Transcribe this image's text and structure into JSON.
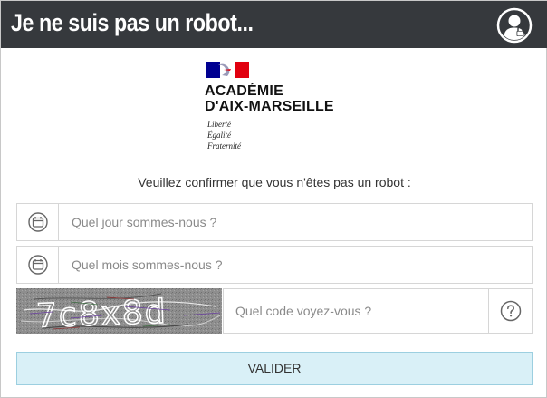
{
  "header": {
    "title": "Je ne suis pas un robot...",
    "icon": "user-lock-icon",
    "background": "#36393d"
  },
  "logo": {
    "line1": "ACADÉMIE",
    "line2": "D'AIX-MARSEILLE",
    "motto": [
      "Liberté",
      "Égalité",
      "Fraternité"
    ],
    "flag_colors": [
      "#000091",
      "#ffffff",
      "#e1000f"
    ]
  },
  "prompt": "Veuillez confirmer que vous n'êtes pas un robot :",
  "fields": {
    "day": {
      "placeholder": "Quel jour sommes-nous ?",
      "value": "",
      "icon": "calendar-icon"
    },
    "month": {
      "placeholder": "Quel mois sommes-nous ?",
      "value": "",
      "icon": "calendar-icon"
    }
  },
  "captcha": {
    "code": "7c8x8d",
    "placeholder": "Quel code voyez-vous ?",
    "value": "",
    "help_icon": "question-circle-icon"
  },
  "submit": {
    "label": "VALIDER",
    "background": "#d9f0f7"
  }
}
